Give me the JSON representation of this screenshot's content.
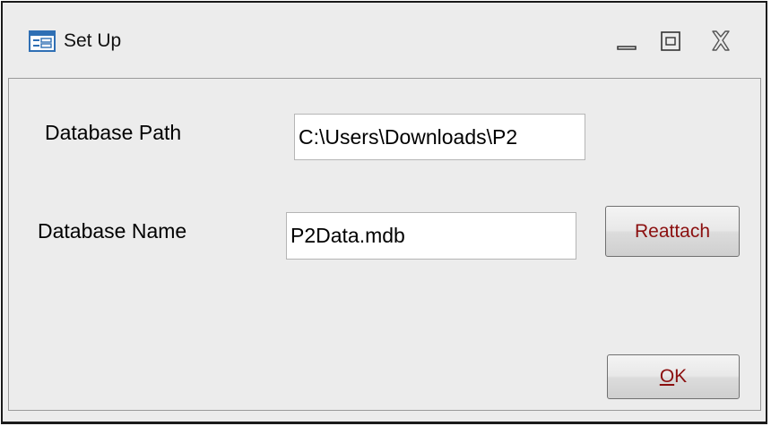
{
  "window": {
    "title": "Set Up"
  },
  "form": {
    "database_path_label": "Database Path",
    "database_path_value": "C:\\Users\\Downloads\\P2",
    "database_name_label": "Database Name",
    "database_name_value": "P2Data.mdb",
    "reattach_label": "Reattach",
    "ok_label_underlined": "O",
    "ok_label_rest": "K"
  },
  "colors": {
    "button_text": "#8b0f0f",
    "form_background": "#ececec"
  }
}
